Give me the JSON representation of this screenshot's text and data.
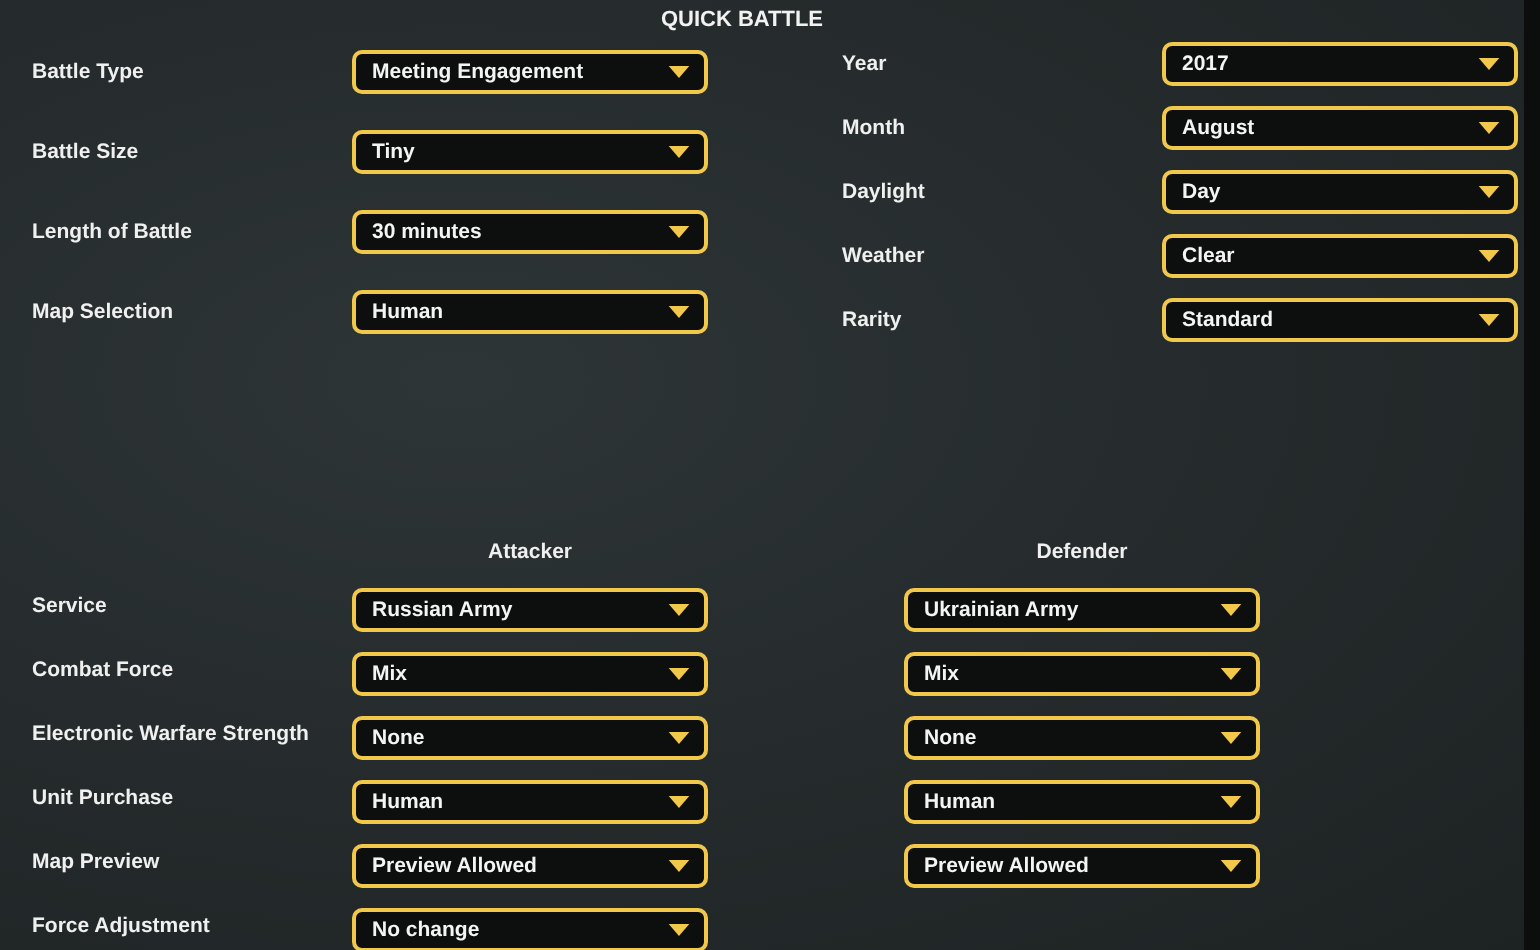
{
  "title": "QUICK BATTLE",
  "settings_left": [
    {
      "label": "Battle Type",
      "value": "Meeting Engagement"
    },
    {
      "label": "Battle Size",
      "value": "Tiny"
    },
    {
      "label": "Length of Battle",
      "value": "30 minutes"
    },
    {
      "label": "Map Selection",
      "value": "Human"
    }
  ],
  "settings_right": [
    {
      "label": "Year",
      "value": "2017"
    },
    {
      "label": "Month",
      "value": "August"
    },
    {
      "label": "Daylight",
      "value": "Day"
    },
    {
      "label": "Weather",
      "value": "Clear"
    },
    {
      "label": "Rarity",
      "value": "Standard"
    }
  ],
  "sides": {
    "headers": [
      "Attacker",
      "Defender"
    ],
    "rows": [
      {
        "label": "Service",
        "attacker": "Russian Army",
        "defender": "Ukrainian Army"
      },
      {
        "label": "Combat Force",
        "attacker": "Mix",
        "defender": "Mix"
      },
      {
        "label": "Electronic Warfare Strength",
        "attacker": "None",
        "defender": "None"
      },
      {
        "label": "Unit Purchase",
        "attacker": "Human",
        "defender": "Human"
      },
      {
        "label": "Map Preview",
        "attacker": "Preview Allowed",
        "defender": "Preview Allowed"
      },
      {
        "label": "Force Adjustment",
        "attacker": "No change"
      }
    ]
  }
}
